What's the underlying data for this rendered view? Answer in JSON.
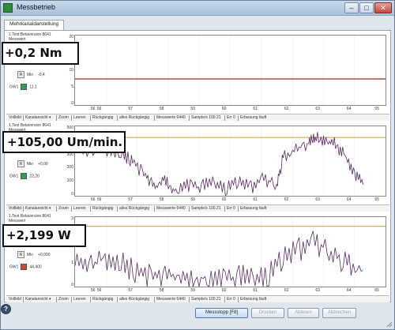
{
  "window": {
    "title": "Messbetrieb",
    "min_label": "–",
    "max_label": "□",
    "close_label": "✕"
  },
  "tab": {
    "label": "Mehrkanaldarstellung"
  },
  "panels": [
    {
      "header_line1": "1.Test Betaversion 8641",
      "header_line2": "Messwert",
      "min_label": "Min",
      "min_value": "-0,4",
      "gw_label": "GW1",
      "gw_value": "11,1",
      "gw_color": "#2aa14a",
      "overlay": "+0,2 Nm",
      "yticks": [
        "20",
        "15",
        "10",
        "5",
        "0"
      ],
      "line_color": "#a0281e"
    },
    {
      "header_line1": "1.Test Betaversion 8641",
      "header_line2": "Messwert",
      "min_label": "Min",
      "min_value": "+0,00",
      "gw_label": "GW1",
      "gw_value": "22,20",
      "gw_color": "#2aa14a",
      "overlay": "+105,00 Um/min.",
      "yticks": [
        "500",
        "400",
        "300",
        "200",
        "100",
        "0"
      ],
      "line_color": "#c6a142"
    },
    {
      "header_line1": "1.Test Betaversion 8641",
      "header_line2": "Messwert",
      "min_label": "Min",
      "min_value": "+0,000",
      "gw_label": "GW1",
      "gw_value": "44,400",
      "gw_color": "#d4452a",
      "overlay": "+2,199 W",
      "yticks": [
        "3",
        "2",
        "1",
        "0"
      ],
      "line_color": "#c6a142"
    }
  ],
  "x_ticks": [
    "56",
    "56",
    "57",
    "58",
    "59",
    "60",
    "61",
    "62",
    "63",
    "64",
    "65"
  ],
  "toolbar": {
    "vollbild": "Vollbild",
    "kanalansicht": "Kanalansicht ▾",
    "zoom": "Zoom",
    "leeren": "Leeren",
    "rueckgaengig": "Rückgängig",
    "alles_rueckgaengig": "alles Rückgängig",
    "messwerte": "Messwerte 6440",
    "samples": "Sample/s 100.21",
    "err": "Err 0",
    "erfassung": "Erfassung läuft"
  },
  "footer": {
    "stop_button": "Messstopp [F8]",
    "button_2": "Drucken",
    "button_3": "Ablesen",
    "button_4": "Abbrechen",
    "help": "?"
  },
  "chart_data": [
    {
      "type": "line",
      "ylim": [
        0,
        20
      ],
      "x_range": [
        55.5,
        65.2
      ],
      "series": [
        {
          "values_x": [
            55.5,
            65.2
          ],
          "values_y": [
            7.5,
            7.5
          ]
        }
      ]
    },
    {
      "type": "line",
      "ylim": [
        0,
        500
      ],
      "x_range": [
        55.5,
        65.2
      ],
      "reference_line": 420,
      "series": [
        {
          "values_x": [
            55.5,
            56.0,
            56.5,
            57.0,
            57.3,
            57.7,
            58.0,
            58.3,
            58.6,
            59.0,
            59.4,
            59.8,
            60.2,
            60.6,
            61.0,
            61.4,
            61.8,
            62.0,
            62.4,
            62.8,
            63.0,
            63.3,
            63.6,
            63.9,
            64.2,
            64.5
          ],
          "values_y": [
            330,
            310,
            330,
            300,
            250,
            140,
            60,
            120,
            40,
            80,
            60,
            110,
            50,
            100,
            60,
            120,
            80,
            280,
            330,
            380,
            420,
            390,
            380,
            300,
            180,
            80
          ]
        }
      ]
    },
    {
      "type": "line",
      "ylim": [
        0,
        3
      ],
      "x_range": [
        55.5,
        65.2
      ],
      "reference_line": 2.6,
      "series": [
        {
          "values_x": [
            55.5,
            56.0,
            56.5,
            57.0,
            57.5,
            58.0,
            58.5,
            59.0,
            59.5,
            60.0,
            60.5,
            61.0,
            61.5,
            62.0,
            62.5,
            63.0,
            63.5,
            64.0,
            64.5
          ],
          "values_y": [
            0.9,
            1.0,
            1.2,
            1.0,
            0.6,
            0.4,
            0.5,
            0.3,
            0.4,
            0.3,
            0.4,
            0.5,
            0.4,
            1.2,
            1.6,
            1.9,
            1.5,
            1.0,
            0.7
          ]
        }
      ]
    }
  ]
}
